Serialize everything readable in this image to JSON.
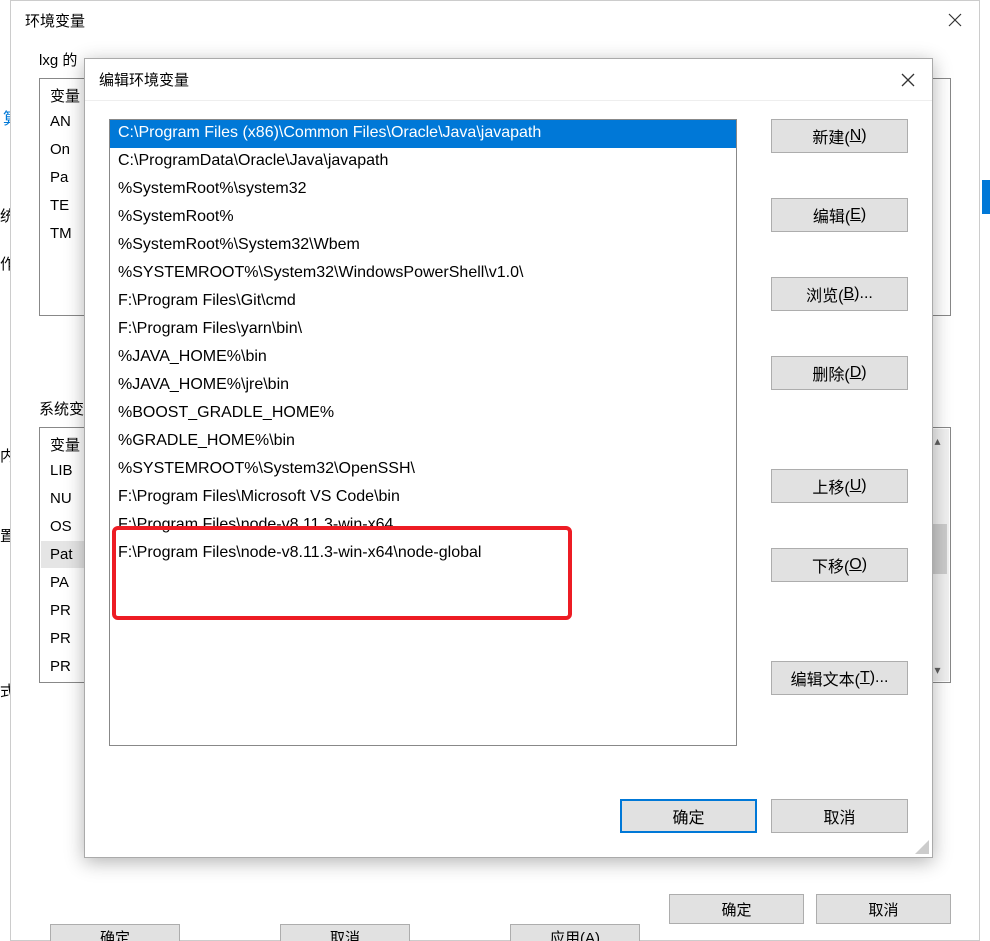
{
  "bg_left": {
    "label_a": "算",
    "label_b": "统",
    "label_c": "作",
    "label_d": "内",
    "label_e": "置",
    "label_f": "式"
  },
  "env_dialog": {
    "title": "环境变量",
    "user_section_label": "lxg 的",
    "user_vars": {
      "header": "变量",
      "rows": [
        "AN",
        "On",
        "Pa",
        "TE",
        "TM"
      ]
    },
    "system_section_label": "系统变",
    "system_vars": {
      "header": "变量",
      "rows": [
        "LIB",
        "NU",
        "OS",
        "Pat",
        "PA",
        "PR",
        "PR",
        "PR"
      ]
    },
    "buttons": {
      "ok": "确定",
      "cancel": "取消"
    }
  },
  "bg_bottom": {
    "ok": "确定",
    "cancel": "取消",
    "apply": "应用(A)"
  },
  "edit_dialog": {
    "title": "编辑环境变量",
    "paths": [
      "C:\\Program Files (x86)\\Common Files\\Oracle\\Java\\javapath",
      "C:\\ProgramData\\Oracle\\Java\\javapath",
      "%SystemRoot%\\system32",
      "%SystemRoot%",
      "%SystemRoot%\\System32\\Wbem",
      "%SYSTEMROOT%\\System32\\WindowsPowerShell\\v1.0\\",
      "F:\\Program Files\\Git\\cmd",
      "F:\\Program Files\\yarn\\bin\\",
      "%JAVA_HOME%\\bin",
      "%JAVA_HOME%\\jre\\bin",
      "%BOOST_GRADLE_HOME%",
      "%GRADLE_HOME%\\bin",
      "%SYSTEMROOT%\\System32\\OpenSSH\\",
      "F:\\Program Files\\Microsoft VS Code\\bin",
      "F:\\Program Files\\node-v8.11.3-win-x64",
      "F:\\Program Files\\node-v8.11.3-win-x64\\node-global"
    ],
    "selected_index": 0,
    "buttons": {
      "new": "新建(",
      "new_u": "N",
      "new_post": ")",
      "edit": "编辑(",
      "edit_u": "E",
      "edit_post": ")",
      "browse": "浏览(",
      "browse_u": "B",
      "browse_post": ")...",
      "delete": "删除(",
      "delete_u": "D",
      "delete_post": ")",
      "move_up": "上移(",
      "move_up_u": "U",
      "move_up_post": ")",
      "move_down": "下移(",
      "move_down_u": "O",
      "move_down_post": ")",
      "edit_text": "编辑文本(",
      "edit_text_u": "T",
      "edit_text_post": ")...",
      "ok": "确定",
      "cancel": "取消"
    }
  }
}
